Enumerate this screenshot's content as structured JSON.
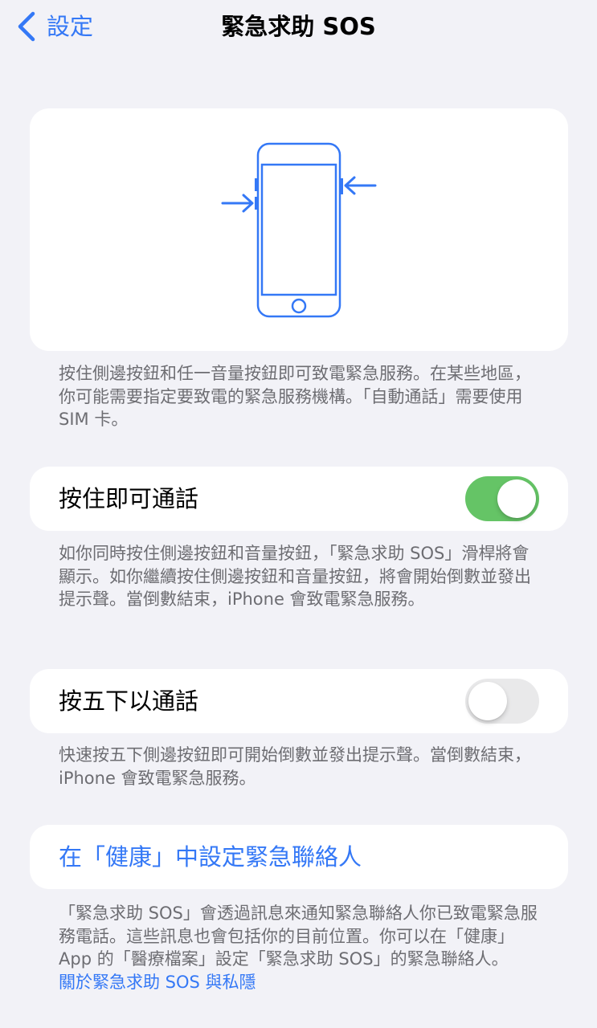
{
  "nav": {
    "back_label": "設定",
    "title": "緊急求助 SOS"
  },
  "illustration_footer": "按住側邊按鈕和任一音量按鈕即可致電緊急服務。在某些地區，你可能需要指定要致電的緊急服務機構。「自動通話」需要使用 SIM 卡。",
  "hold_to_call": {
    "label": "按住即可通話",
    "enabled": true,
    "footer": "如你同時按住側邊按鈕和音量按鈕，「緊急求助 SOS」滑桿將會顯示。如你繼續按住側邊按鈕和音量按鈕，將會開始倒數並發出提示聲。當倒數結束，iPhone 會致電緊急服務。"
  },
  "press_five_times": {
    "label": "按五下以通話",
    "enabled": false,
    "footer": "快速按五下側邊按鈕即可開始倒數並發出提示聲。當倒數結束，iPhone 會致電緊急服務。"
  },
  "emergency_contacts": {
    "link_label": "在「健康」中設定緊急聯絡人",
    "footer": "「緊急求助 SOS」會透過訊息來通知緊急聯絡人你已致電緊急服務電話。這些訊息也會包括你的目前位置。你可以在「健康」App 的「醫療檔案」設定「緊急求助 SOS」的緊急聯絡人。",
    "privacy_link": "關於緊急求助 SOS 與私隱"
  },
  "colors": {
    "accent": "#3478f6",
    "toggle_on": "#65c466",
    "toggle_off": "#e9e9ea",
    "background": "#f2f2f7",
    "footer_text": "#6d6d72"
  },
  "icons": [
    "chevron-left-icon",
    "iphone-icon",
    "arrow-right-icon",
    "arrow-left-icon"
  ]
}
